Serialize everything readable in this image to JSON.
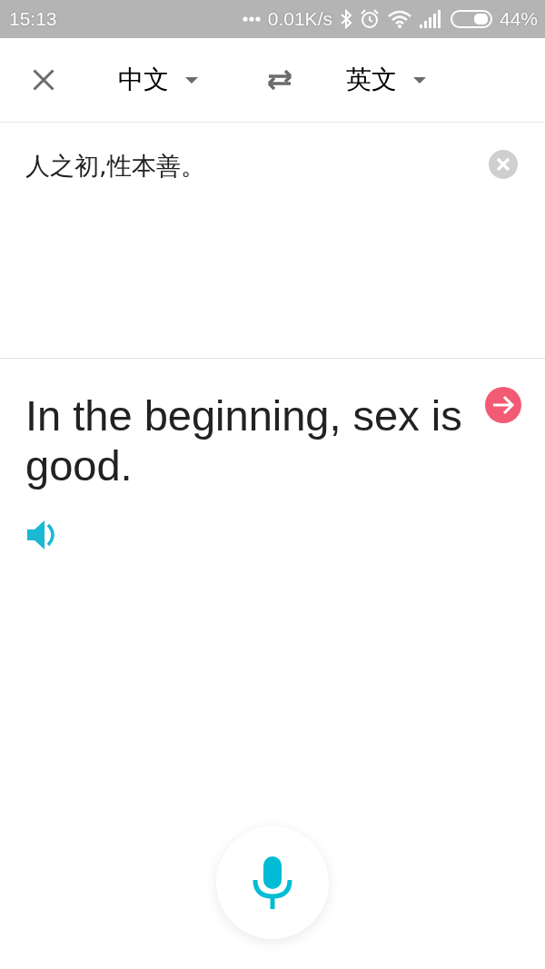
{
  "status_bar": {
    "time": "15:13",
    "network_speed": "0.01K/s",
    "battery": "44%"
  },
  "toolbar": {
    "source_language": "中文",
    "target_language": "英文"
  },
  "input": {
    "value": "人之初,性本善。"
  },
  "result": {
    "text": "In the beginning, sex is good."
  }
}
